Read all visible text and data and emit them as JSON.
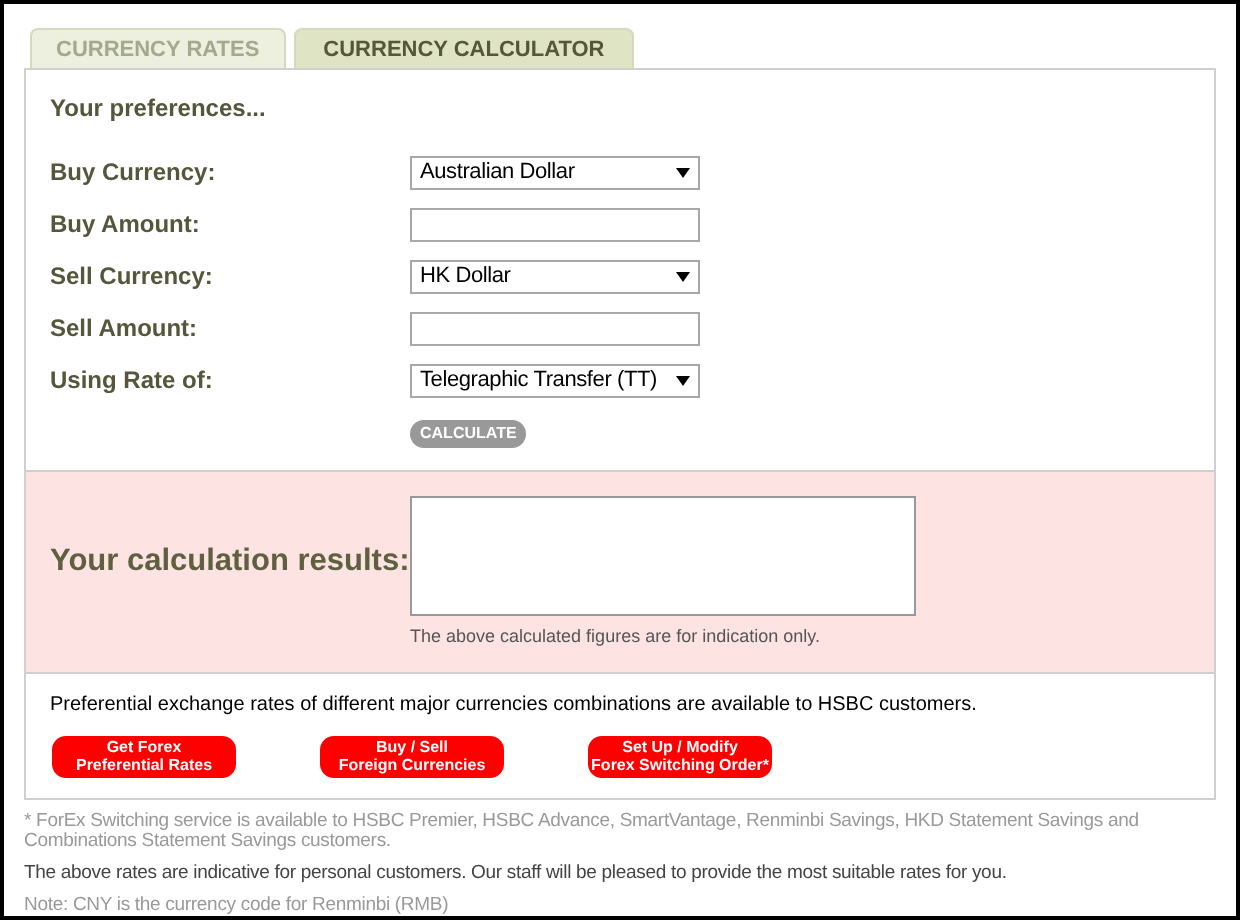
{
  "tabs": [
    {
      "label": "CURRENCY RATES",
      "selected": false
    },
    {
      "label": "CURRENCY CALCULATOR",
      "selected": true
    }
  ],
  "preferences": {
    "heading": "Your preferences...",
    "fields": [
      {
        "label": "Buy Currency:",
        "kind": "select",
        "value": "Australian Dollar"
      },
      {
        "label": "Buy Amount:",
        "kind": "input"
      },
      {
        "label": "Sell Currency:",
        "kind": "select",
        "value": "HK Dollar"
      },
      {
        "label": "Sell Amount:",
        "kind": "input"
      },
      {
        "label": "Using Rate of:",
        "kind": "select",
        "value": "Telegraphic Transfer (TT)"
      }
    ],
    "calculate_button": "CALCULATE"
  },
  "results": {
    "label": "Your calculation results:",
    "note": "The above calculated figures are for indication only."
  },
  "offers": {
    "text": "Preferential exchange rates of different major currencies combinations are available to HSBC customers.",
    "buttons": [
      "Get Forex\nPreferential Rates",
      "Buy / Sell\nForeign Currencies",
      "Set Up / Modify\nForex Switching Order*"
    ]
  },
  "footnotes": [
    {
      "text": "* ForEx Switching service is available to HSBC Premier, HSBC Advance, SmartVantage, Renminbi Savings, HKD Statement Savings and Combinations Statement Savings customers.",
      "kind": "muted"
    },
    {
      "text": "The above rates are indicative for personal customers. Our staff will be pleased to provide the most suitable rates for you.",
      "kind": "normal"
    },
    {
      "text": "Note: CNY is the currency code for Renminbi (RMB)",
      "kind": "muted"
    }
  ]
}
